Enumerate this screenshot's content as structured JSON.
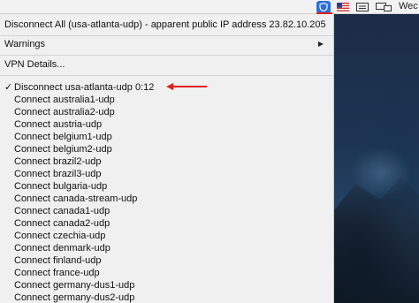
{
  "menubar": {
    "right_text": "Wec",
    "icons": [
      "vpn-shield-icon",
      "us-flag-icon",
      "input-menu-icon",
      "display-icon"
    ]
  },
  "menu": {
    "header": "Disconnect All (usa-atlanta-udp) - apparent public IP address 23.82.10.205",
    "warnings": "Warnings",
    "vpn_details": "VPN Details...",
    "active": "Disconnect usa-atlanta-udp 0:12",
    "connections": [
      "Connect australia1-udp",
      "Connect australia2-udp",
      "Connect austria-udp",
      "Connect belgium1-udp",
      "Connect belgium2-udp",
      "Connect brazil2-udp",
      "Connect brazil3-udp",
      "Connect bulgaria-udp",
      "Connect canada-stream-udp",
      "Connect canada1-udp",
      "Connect canada2-udp",
      "Connect czechia-udp",
      "Connect denmark-udp",
      "Connect finland-udp",
      "Connect france-udp",
      "Connect germany-dus1-udp",
      "Connect germany-dus2-udp"
    ]
  },
  "colors": {
    "accent": "#2a6fe0",
    "annotation": "#e02020"
  }
}
